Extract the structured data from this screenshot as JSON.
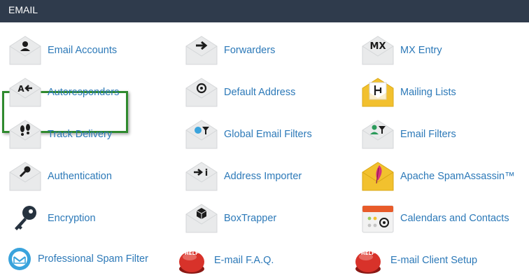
{
  "section": {
    "title": "EMAIL"
  },
  "items": [
    {
      "label": "Email Accounts"
    },
    {
      "label": "Forwarders"
    },
    {
      "label": "MX Entry",
      "glyph": "MX"
    },
    {
      "label": "Autoresponders",
      "glyph": "A"
    },
    {
      "label": "Default Address"
    },
    {
      "label": "Mailing Lists"
    },
    {
      "label": "Track Delivery"
    },
    {
      "label": "Global Email Filters"
    },
    {
      "label": "Email Filters"
    },
    {
      "label": "Authentication"
    },
    {
      "label": "Address Importer",
      "glyph": "i"
    },
    {
      "label": "Apache SpamAssassin™"
    },
    {
      "label": "Encryption"
    },
    {
      "label": "BoxTrapper"
    },
    {
      "label": "Calendars and Contacts"
    },
    {
      "label": "Professional Spam Filter"
    },
    {
      "label": "E-mail F.A.Q.",
      "badge": "HELP"
    },
    {
      "label": "E-mail Client Setup",
      "badge": "HELP"
    }
  ],
  "colors": {
    "header_bg": "#2f3b4c",
    "link": "#2c79b8",
    "highlight_border": "#2f8a2e",
    "envelope": "#e9eaeb",
    "envelope_yellow": "#f2c12e",
    "help_red": "#d8322a",
    "spam_blue": "#3aa3dc"
  }
}
